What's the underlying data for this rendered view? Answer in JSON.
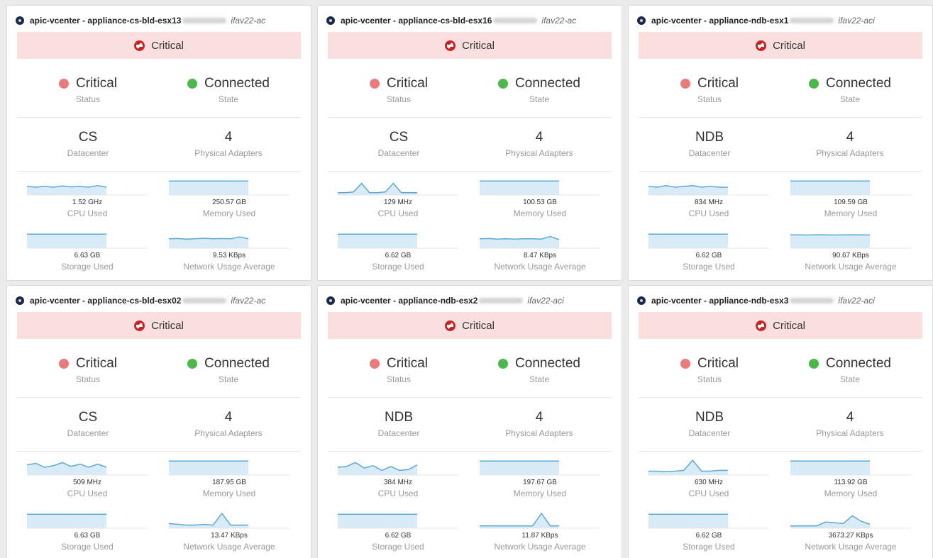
{
  "cards": [
    {
      "title": "apic-vcenter - appliance-cs-bld-esx13",
      "fabric": "ifav22-ac",
      "health": "Critical",
      "status": {
        "value": "Critical",
        "label": "Status"
      },
      "state": {
        "value": "Connected",
        "label": "State"
      },
      "datacenter": {
        "value": "CS",
        "label": "Datacenter"
      },
      "adapters": {
        "value": "4",
        "label": "Physical Adapters"
      },
      "metrics": [
        {
          "value": "1.52 GHz",
          "label": "CPU Used",
          "series": [
            0.55,
            0.5,
            0.55,
            0.5,
            0.58,
            0.52,
            0.55,
            0.5,
            0.6,
            0.5
          ]
        },
        {
          "value": "250.57 GB",
          "label": "Memory Used",
          "series": [
            0.9,
            0.9,
            0.9,
            0.9,
            0.9,
            0.9,
            0.9,
            0.9,
            0.9,
            0.9
          ]
        },
        {
          "value": "6.63 GB",
          "label": "Storage Used",
          "series": [
            0.9,
            0.9,
            0.9,
            0.9,
            0.9,
            0.9,
            0.9,
            0.9,
            0.9,
            0.9
          ]
        },
        {
          "value": "9.53 KBps",
          "label": "Network Usage Average",
          "series": [
            0.6,
            0.62,
            0.58,
            0.6,
            0.63,
            0.6,
            0.62,
            0.6,
            0.72,
            0.6
          ]
        }
      ]
    },
    {
      "title": "apic-vcenter - appliance-cs-bld-esx16",
      "fabric": "ifav22-ac",
      "health": "Critical",
      "status": {
        "value": "Critical",
        "label": "Status"
      },
      "state": {
        "value": "Connected",
        "label": "State"
      },
      "datacenter": {
        "value": "CS",
        "label": "Datacenter"
      },
      "adapters": {
        "value": "4",
        "label": "Physical Adapters"
      },
      "metrics": [
        {
          "value": "129 MHz",
          "label": "CPU Used",
          "series": [
            0.15,
            0.15,
            0.2,
            0.75,
            0.15,
            0.15,
            0.2,
            0.75,
            0.15,
            0.15,
            0.15
          ]
        },
        {
          "value": "100.53 GB",
          "label": "Memory Used",
          "series": [
            0.9,
            0.9,
            0.9,
            0.9,
            0.9,
            0.9,
            0.9,
            0.9,
            0.9,
            0.9
          ]
        },
        {
          "value": "6.62 GB",
          "label": "Storage Used",
          "series": [
            0.9,
            0.9,
            0.9,
            0.9,
            0.9,
            0.9,
            0.9,
            0.9,
            0.9,
            0.9
          ]
        },
        {
          "value": "8.47 KBps",
          "label": "Network Usage Average",
          "series": [
            0.6,
            0.62,
            0.58,
            0.6,
            0.58,
            0.6,
            0.6,
            0.58,
            0.75,
            0.55
          ]
        }
      ]
    },
    {
      "title": "apic-vcenter - appliance-ndb-esx1",
      "fabric": "ifav22-aci",
      "health": "Critical",
      "status": {
        "value": "Critical",
        "label": "Status"
      },
      "state": {
        "value": "Connected",
        "label": "State"
      },
      "datacenter": {
        "value": "NDB",
        "label": "Datacenter"
      },
      "adapters": {
        "value": "4",
        "label": "Physical Adapters"
      },
      "metrics": [
        {
          "value": "834 MHz",
          "label": "CPU Used",
          "series": [
            0.55,
            0.5,
            0.6,
            0.5,
            0.55,
            0.6,
            0.5,
            0.55,
            0.5,
            0.5
          ]
        },
        {
          "value": "109.59 GB",
          "label": "Memory Used",
          "series": [
            0.9,
            0.9,
            0.9,
            0.9,
            0.9,
            0.9,
            0.9,
            0.9,
            0.9,
            0.9
          ]
        },
        {
          "value": "6.62 GB",
          "label": "Storage Used",
          "series": [
            0.9,
            0.9,
            0.9,
            0.9,
            0.9,
            0.9,
            0.9,
            0.9,
            0.9,
            0.9
          ]
        },
        {
          "value": "90.67 KBps",
          "label": "Network Usage Average",
          "series": [
            0.85,
            0.85,
            0.84,
            0.86,
            0.85,
            0.84,
            0.85,
            0.86,
            0.85,
            0.84
          ]
        }
      ]
    },
    {
      "title": "apic-vcenter - appliance-cs-bld-esx02",
      "fabric": "ifav22-ac",
      "health": "Critical",
      "status": {
        "value": "Critical",
        "label": "Status"
      },
      "state": {
        "value": "Connected",
        "label": "State"
      },
      "datacenter": {
        "value": "CS",
        "label": "Datacenter"
      },
      "adapters": {
        "value": "4",
        "label": "Physical Adapters"
      },
      "metrics": [
        {
          "value": "509 MHz",
          "label": "CPU Used",
          "series": [
            0.65,
            0.75,
            0.5,
            0.6,
            0.8,
            0.55,
            0.7,
            0.5,
            0.7,
            0.5
          ]
        },
        {
          "value": "187.95 GB",
          "label": "Memory Used",
          "series": [
            0.9,
            0.9,
            0.9,
            0.9,
            0.9,
            0.9,
            0.9,
            0.9,
            0.9,
            0.9
          ]
        },
        {
          "value": "6.63 GB",
          "label": "Storage Used",
          "series": [
            0.9,
            0.9,
            0.9,
            0.9,
            0.9,
            0.9,
            0.9,
            0.9,
            0.9,
            0.9
          ]
        },
        {
          "value": "13.47 KBps",
          "label": "Network Usage Average",
          "series": [
            0.3,
            0.25,
            0.2,
            0.2,
            0.25,
            0.2,
            0.95,
            0.2,
            0.2,
            0.2
          ]
        }
      ]
    },
    {
      "title": "apic-vcenter - appliance-ndb-esx2",
      "fabric": "ifav22-aci",
      "health": "Critical",
      "status": {
        "value": "Critical",
        "label": "Status"
      },
      "state": {
        "value": "Connected",
        "label": "State"
      },
      "datacenter": {
        "value": "NDB",
        "label": "Datacenter"
      },
      "adapters": {
        "value": "4",
        "label": "Physical Adapters"
      },
      "metrics": [
        {
          "value": "384 MHz",
          "label": "CPU Used",
          "series": [
            0.5,
            0.55,
            0.8,
            0.45,
            0.6,
            0.3,
            0.55,
            0.3,
            0.35,
            0.65
          ]
        },
        {
          "value": "197.67 GB",
          "label": "Memory Used",
          "series": [
            0.9,
            0.9,
            0.9,
            0.9,
            0.9,
            0.9,
            0.9,
            0.9,
            0.9,
            0.9
          ]
        },
        {
          "value": "6.62 GB",
          "label": "Storage Used",
          "series": [
            0.9,
            0.9,
            0.9,
            0.9,
            0.9,
            0.9,
            0.9,
            0.9,
            0.9,
            0.9
          ]
        },
        {
          "value": "11.87 KBps",
          "label": "Network Usage Average",
          "series": [
            0.15,
            0.15,
            0.15,
            0.15,
            0.15,
            0.15,
            0.15,
            0.95,
            0.15,
            0.15
          ]
        }
      ]
    },
    {
      "title": "apic-vcenter - appliance-ndb-esx3",
      "fabric": "ifav22-aci",
      "health": "Critical",
      "status": {
        "value": "Critical",
        "label": "Status"
      },
      "state": {
        "value": "Connected",
        "label": "State"
      },
      "datacenter": {
        "value": "NDB",
        "label": "Datacenter"
      },
      "adapters": {
        "value": "4",
        "label": "Physical Adapters"
      },
      "metrics": [
        {
          "value": "630 MHz",
          "label": "CPU Used",
          "series": [
            0.25,
            0.25,
            0.22,
            0.25,
            0.3,
            0.95,
            0.25,
            0.25,
            0.3,
            0.3
          ]
        },
        {
          "value": "113.92 GB",
          "label": "Memory Used",
          "series": [
            0.9,
            0.9,
            0.9,
            0.9,
            0.9,
            0.9,
            0.9,
            0.9,
            0.9,
            0.9
          ]
        },
        {
          "value": "6.62 GB",
          "label": "Storage Used",
          "series": [
            0.9,
            0.9,
            0.9,
            0.9,
            0.9,
            0.9,
            0.9,
            0.9,
            0.9,
            0.9
          ]
        },
        {
          "value": "3673.27 KBps",
          "label": "Network Usage Average",
          "series": [
            0.15,
            0.15,
            0.15,
            0.15,
            0.4,
            0.35,
            0.3,
            0.8,
            0.45,
            0.25
          ]
        }
      ]
    }
  ],
  "colors": {
    "critical": "#c82222",
    "critical_banner": "#f9e0df",
    "status_dot": "#e87b7b",
    "connected_dot": "#4cb84c",
    "spark_line": "#5aa9d6",
    "spark_fill": "#d9ebf7"
  },
  "icons": {
    "host": "host-icon",
    "health": "critical-icon"
  }
}
